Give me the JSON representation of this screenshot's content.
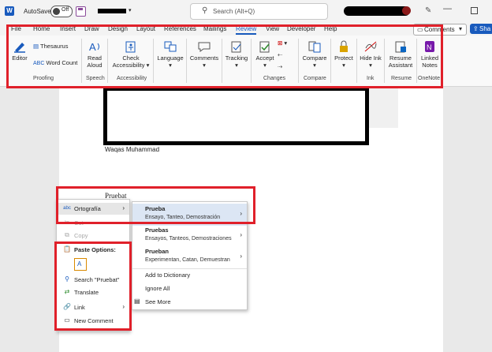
{
  "titlebar": {
    "app_icon_letter": "W",
    "autosave_label": "AutoSave",
    "autosave_state": "Off",
    "search_placeholder": "Search (Alt+Q)"
  },
  "tabs": [
    "File",
    "Home",
    "Insert",
    "Draw",
    "Design",
    "Layout",
    "References",
    "Mailings",
    "Review",
    "View",
    "Developer",
    "Help"
  ],
  "active_tab": "Review",
  "comments_label": "Comments",
  "share_label": "Sha",
  "ribbon": {
    "editor": "Editor",
    "thesaurus": "Thesaurus",
    "word_count": "Word Count",
    "read_aloud": "Read Aloud",
    "check_accessibility": "Check Accessibility",
    "language": "Language",
    "comments": "Comments",
    "tracking": "Tracking",
    "accept": "Accept",
    "compare": "Compare",
    "protect": "Protect",
    "hide_ink": "Hide Ink",
    "resume_assistant": "Resume Assistant",
    "linked_notes": "Linked Notes",
    "groups": {
      "proofing": "Proofing",
      "speech": "Speech",
      "accessibility": "Accessibility",
      "changes": "Changes",
      "compare": "Compare",
      "ink": "Ink",
      "resume": "Resume",
      "onenote": "OneNote"
    }
  },
  "document": {
    "author": "Waqas Muhammad",
    "misspelled_word": "Pruebat"
  },
  "context_menu": {
    "spelling": "Ortografía",
    "cut": "Cut",
    "copy": "Copy",
    "paste_options": "Paste Options:",
    "search": "Search \"Pruebat\"",
    "translate": "Translate",
    "link": "Link",
    "new_comment": "New Comment"
  },
  "suggestions": [
    {
      "word": "Prueba",
      "synonyms": "Ensayo, Tanteo, Demostración"
    },
    {
      "word": "Pruebas",
      "synonyms": "Ensayos, Tanteos, Demostraciones"
    },
    {
      "word": "Prueban",
      "synonyms": "Experimentan, Catan, Demuestran"
    }
  ],
  "submenu_actions": {
    "add_to_dictionary": "Add to Dictionary",
    "ignore_all": "Ignore All",
    "see_more": "See More"
  },
  "colors": {
    "accent": "#185abd",
    "highlight_red": "#e0202a",
    "onenote_purple": "#7719aa"
  }
}
